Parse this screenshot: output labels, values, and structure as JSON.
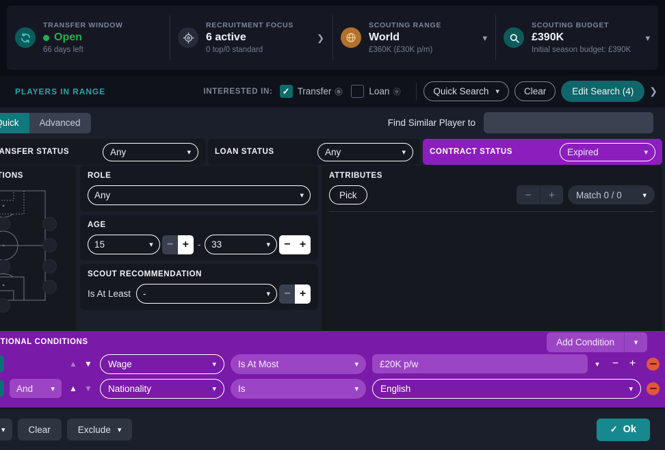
{
  "topbar": {
    "stats": [
      {
        "label": "TRANSFER WINDOW",
        "value": "Open",
        "sub": "66 days left",
        "icon": "refresh-icon"
      },
      {
        "label": "RECRUITMENT FOCUS",
        "value": "6 active",
        "sub": "0 top/0 standard",
        "icon": "target-icon"
      },
      {
        "label": "SCOUTING RANGE",
        "value": "World",
        "sub": "£360K (£30K p/m)",
        "icon": "globe-icon"
      },
      {
        "label": "SCOUTING BUDGET",
        "value": "£390K",
        "sub": "Initial season budget: £390K",
        "icon": "magnifier-icon"
      }
    ]
  },
  "toolbar": {
    "title": "PLAYERS IN RANGE",
    "interested_label": "INTERESTED IN:",
    "transfer_label": "Transfer",
    "loan_label": "Loan",
    "quick_search_label": "Quick Search",
    "clear_label": "Clear",
    "edit_search_label": "Edit Search (4)"
  },
  "tabs": {
    "items": [
      {
        "label": "Quick",
        "active": true
      },
      {
        "label": "Advanced",
        "active": false
      }
    ],
    "find_similar_label": "Find Similar Player to",
    "find_similar_value": ""
  },
  "status": {
    "transfer_status_label": "TRANSFER STATUS",
    "transfer_status_value": "Any",
    "loan_status_label": "LOAN STATUS",
    "loan_status_value": "Any",
    "contract_status_label": "CONTRACT STATUS",
    "contract_status_value": "Expired"
  },
  "positions": {
    "title": "POSITIONS"
  },
  "role": {
    "title": "ROLE",
    "value": "Any"
  },
  "age": {
    "title": "AGE",
    "min": "15",
    "max": "33",
    "separator": "-"
  },
  "scout": {
    "title": "SCOUT RECOMMENDATION",
    "qualifier": "Is At Least",
    "value": "-"
  },
  "attributes": {
    "title": "ATTRIBUTES",
    "pick_label": "Pick",
    "match_label": "Match 0 / 0"
  },
  "conditions": {
    "title": "ADDITIONAL CONDITIONS",
    "add_label": "Add Condition",
    "rows": [
      {
        "joiner": "",
        "field": "Wage",
        "operator": "Is At Most",
        "value": "£20K p/w",
        "has_stepper": true
      },
      {
        "joiner": "And",
        "field": "Nationality",
        "operator": "Is",
        "value": "English",
        "has_stepper": false
      }
    ]
  },
  "bottom": {
    "left_dropdown": "",
    "clear_label": "Clear",
    "exclude_label": "Exclude",
    "ok_label": "Ok"
  },
  "colors": {
    "teal": "#11787d",
    "purple": "#7a1aa8",
    "purple_light": "#9c45c4",
    "green": "#22b04d",
    "red": "#e2563c"
  }
}
